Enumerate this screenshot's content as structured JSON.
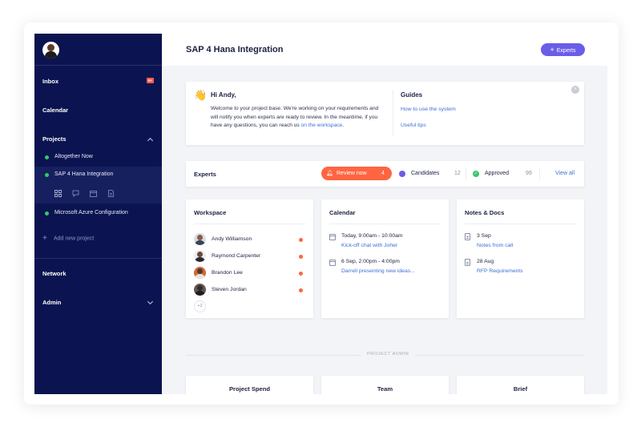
{
  "sidebar": {
    "inbox": "Inbox",
    "inbox_badge": "9+",
    "calendar": "Calendar",
    "projects": "Projects",
    "project_items": [
      {
        "label": "Altogether Now",
        "status_color": "#35c86a"
      },
      {
        "label": "SAP 4 Hana Integration",
        "status_color": "#35c86a"
      },
      {
        "label": "Microsoft Azure Configuration",
        "status_color": "#35c86a"
      }
    ],
    "sub_icons": [
      "grid-icon",
      "chat-icon",
      "calendar-icon",
      "document-icon"
    ],
    "add_project": "Add new project",
    "network": "Network",
    "admin": "Admin"
  },
  "header": {
    "title": "SAP 4 Hana Integration",
    "experts_button": "Experts"
  },
  "welcome": {
    "greeting": "Hi Andy,",
    "text": "Welcome to your project base. We're working on your requirements and will notify you when experts are ready to review. In the meantime, if you have any questions, you can reach us ",
    "link": "on the workspace",
    "text_end": ".",
    "guides_title": "Guides",
    "guides": [
      "How to use the system",
      "Useful tips"
    ]
  },
  "experts_bar": {
    "title": "Experts",
    "review_label": "Review now",
    "review_count": "4",
    "candidates_label": "Candidates",
    "candidates_count": "12",
    "approved_label": "Approved",
    "approved_count": "99",
    "view_all": "View all"
  },
  "workspace": {
    "title": "Workspace",
    "members": [
      {
        "name": "Andy Williamson"
      },
      {
        "name": "Raymond Carpenter"
      },
      {
        "name": "Brandon Lee"
      },
      {
        "name": "Steven Jordan"
      }
    ],
    "more": "+2"
  },
  "calendar": {
    "title": "Calendar",
    "events": [
      {
        "time": "Today, 9:00am - 10:00am",
        "title": "Kick-off chat with Joher"
      },
      {
        "time": "6 Sep, 2:00pm - 4:00pm",
        "title": "Darrell presenting new ideas..."
      }
    ]
  },
  "notes": {
    "title": "Notes & Docs",
    "items": [
      {
        "date": "3 Sep",
        "title": "Notes from call"
      },
      {
        "date": "28 Aug",
        "title": "RFP Requirements"
      }
    ]
  },
  "project_admin": {
    "label": "PROJECT ADMIN",
    "cards": [
      "Project Spend",
      "Team",
      "Brief"
    ]
  },
  "colors": {
    "sidebar_bg": "#0b1450",
    "accent_purple": "#6b5de8",
    "review_orange": "#ff6541",
    "approved_green": "#35c86a",
    "link_blue": "#3b6fd6"
  }
}
